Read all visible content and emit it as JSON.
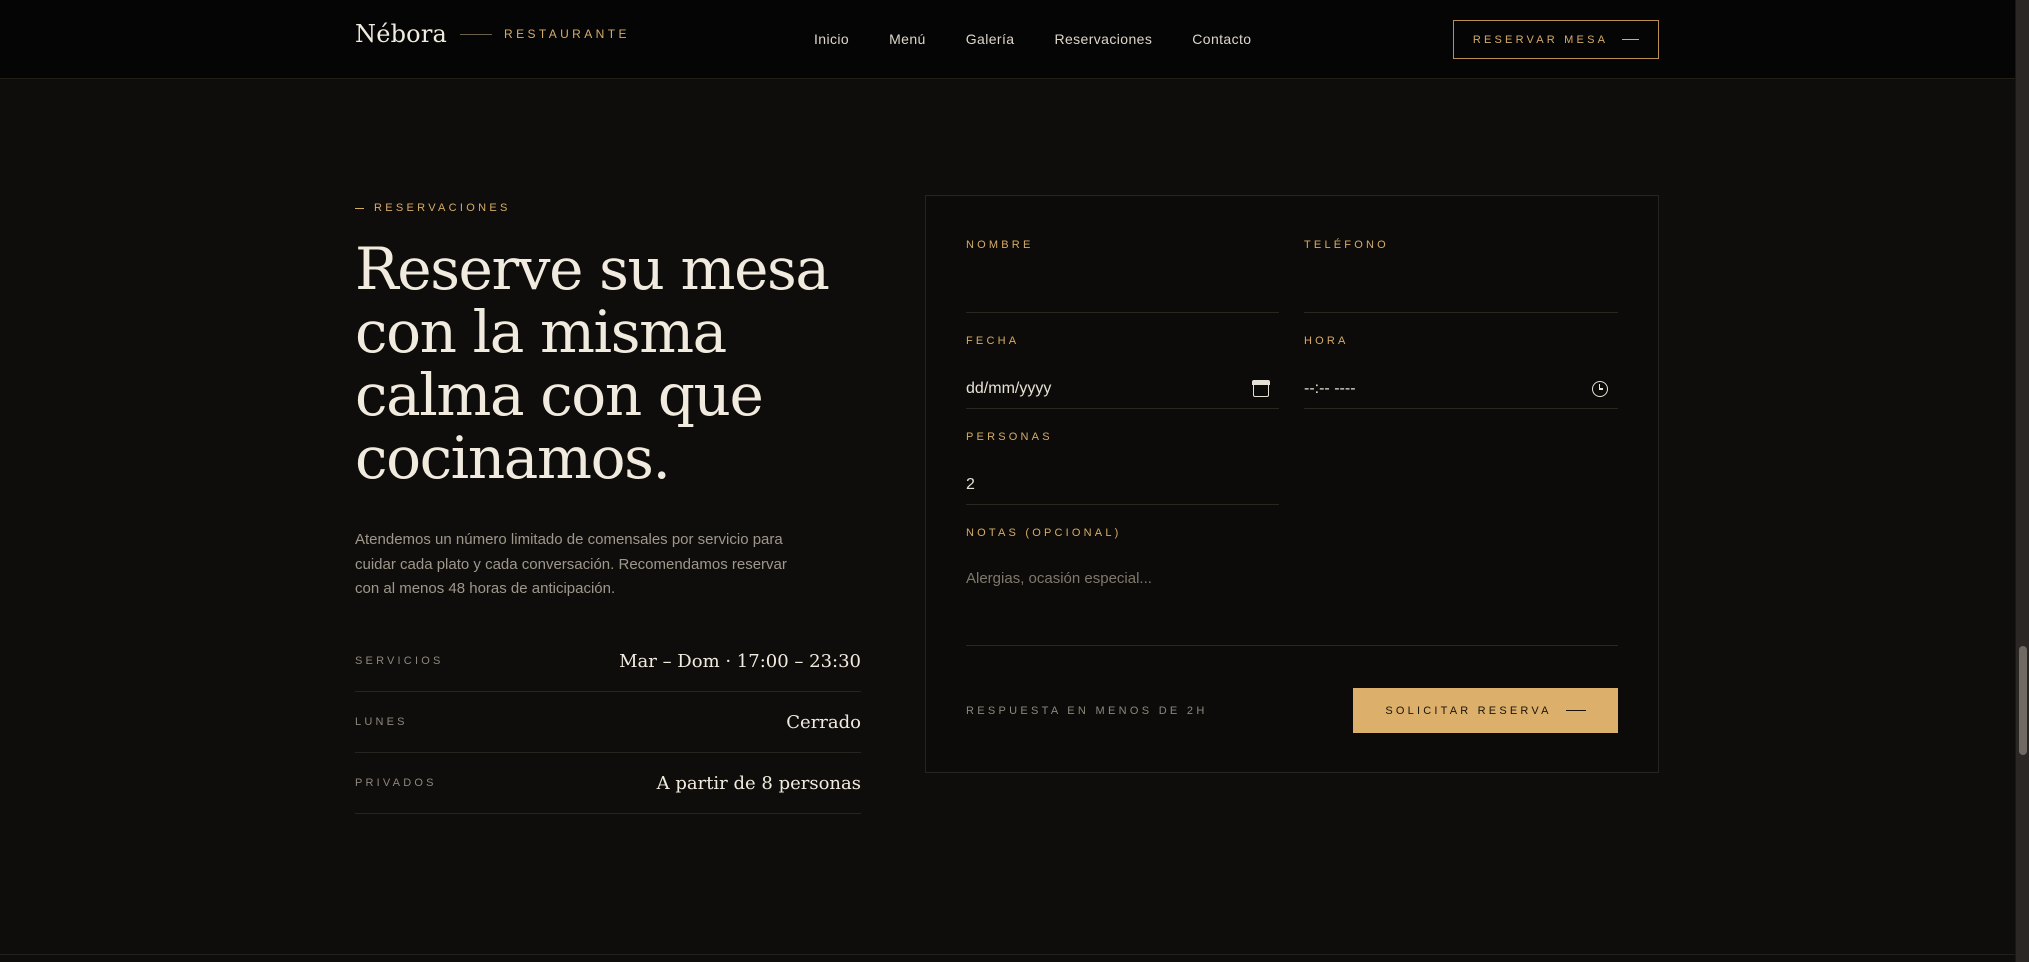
{
  "header": {
    "brand_name": "Nébora",
    "brand_tagline": "RESTAURANTE",
    "nav": [
      "Inicio",
      "Menú",
      "Galería",
      "Reservaciones",
      "Contacto"
    ],
    "cta_label": "RESERVAR MESA"
  },
  "hero": {
    "eyebrow": "RESERVACIONES",
    "headline_lines": [
      "Reserve su mesa",
      "con la misma",
      "calma con que",
      "cocinamos."
    ],
    "intro": "Atendemos un número limitado de comensales por servicio para cuidar cada plato y cada conversación. Recomendamos reservar con al menos 48 horas de anticipación.",
    "info": [
      {
        "label": "SERVICIOS",
        "value": "Mar – Dom · 17:00 – 23:30"
      },
      {
        "label": "LUNES",
        "value": "Cerrado"
      },
      {
        "label": "PRIVADOS",
        "value": "A partir de 8 personas"
      }
    ]
  },
  "form": {
    "nombre_label": "NOMBRE",
    "nombre_value": "",
    "telefono_label": "TELÉFONO",
    "telefono_value": "",
    "fecha_label": "FECHA",
    "fecha_value": "dd/mm/yyyy",
    "hora_label": "HORA",
    "hora_value": "--:-- ----",
    "personas_label": "PERSONAS",
    "personas_value": "2",
    "notas_label": "NOTAS (OPCIONAL)",
    "notas_placeholder": "Alergias, ocasión especial...",
    "response_note": "RESPUESTA EN MENOS DE 2H",
    "submit_label": "SOLICITAR RESERVA"
  },
  "icons": {
    "date_picker": "calendar-icon",
    "time_picker": "clock-icon",
    "cta_arrow": "arrow-line-icon"
  },
  "colors": {
    "accent": "#dcb06b",
    "background": "#0f0d0b",
    "header_background": "#050505",
    "text": "#f1ebdf"
  }
}
